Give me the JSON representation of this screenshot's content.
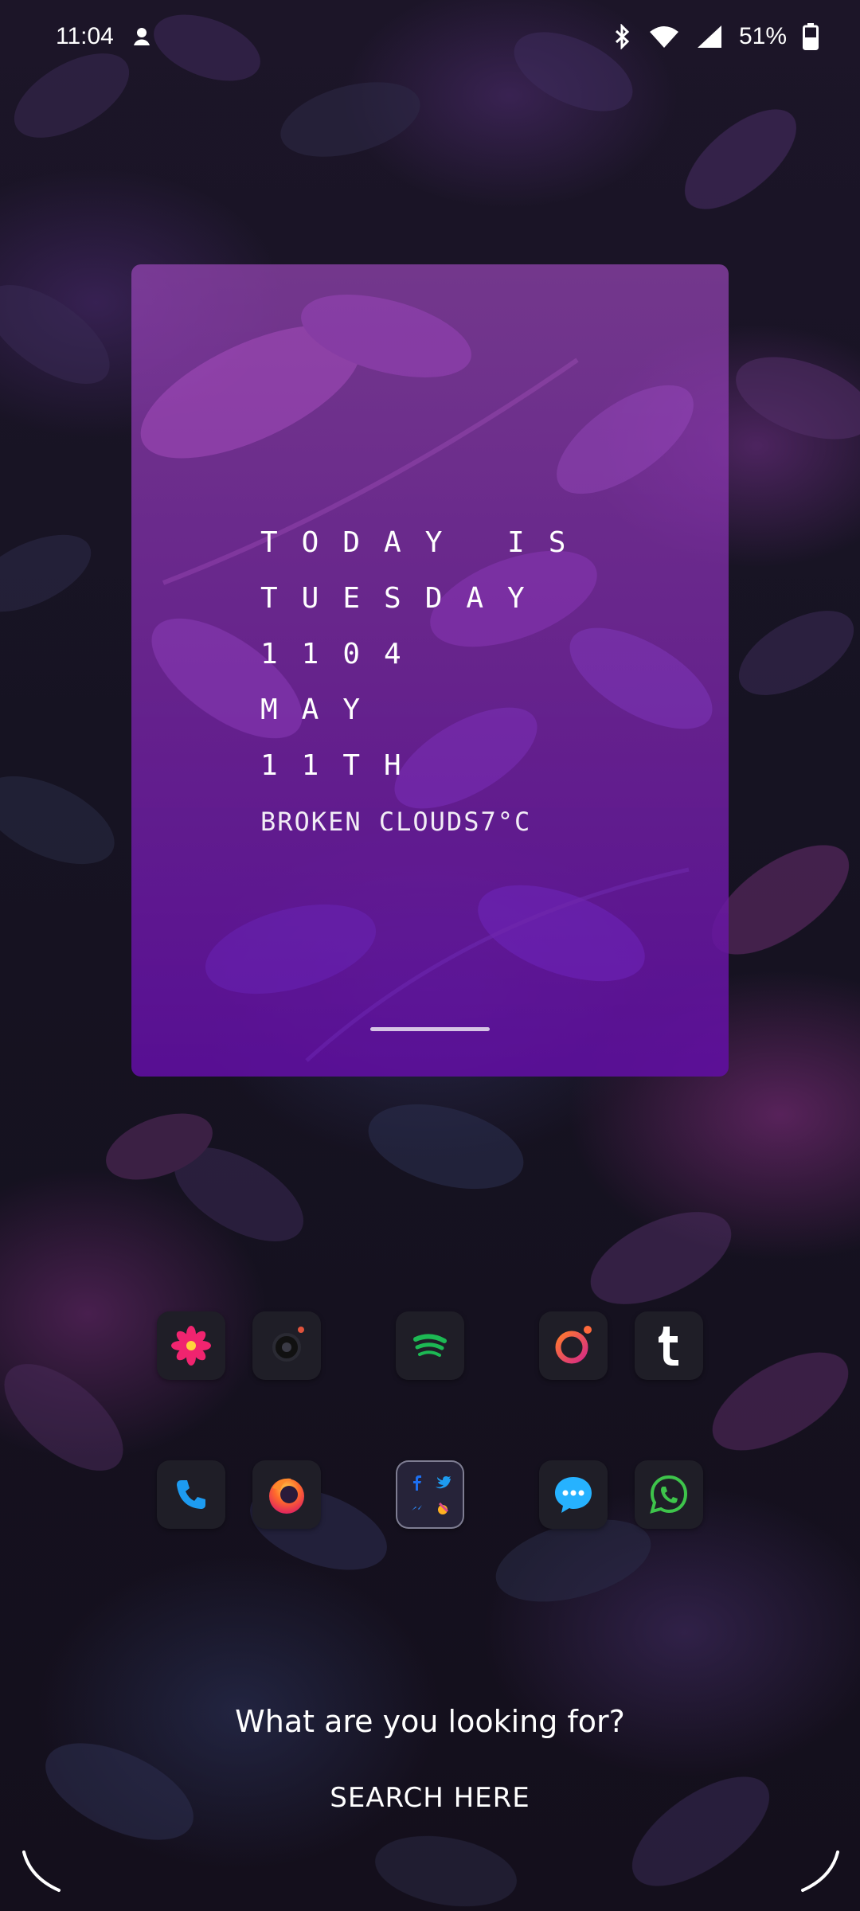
{
  "status_bar": {
    "time": "11:04",
    "battery": "51%",
    "icons": [
      "notification-app-icon",
      "bluetooth-icon",
      "wifi-icon",
      "cell-signal-icon",
      "battery-icon"
    ]
  },
  "widget": {
    "lines": [
      "TODAY IS",
      "TUESDAY",
      "1104",
      "MAY",
      "11TH"
    ],
    "weather": "BROKEN CLOUDS7°C"
  },
  "apps": {
    "row1": [
      {
        "name": "flower-app",
        "color": "#f0246f"
      },
      {
        "name": "camera-app",
        "color": "#e0533c"
      },
      {
        "name": "spotify",
        "color": "#1db954"
      },
      {
        "name": "ring-app",
        "color": "#f2643c"
      },
      {
        "name": "tumblr",
        "color": "#ffffff"
      }
    ],
    "row2": [
      {
        "name": "phone",
        "color": "#1d9bf0"
      },
      {
        "name": "firefox",
        "color": "#ff6a2b"
      },
      {
        "name": "social-folder",
        "color": "#1d9bf0"
      },
      {
        "name": "messages",
        "color": "#26b2ff"
      },
      {
        "name": "whatsapp",
        "color": "#3ec44b"
      }
    ]
  },
  "search": {
    "prompt": "What are you looking for?",
    "button": "SEARCH HERE"
  }
}
